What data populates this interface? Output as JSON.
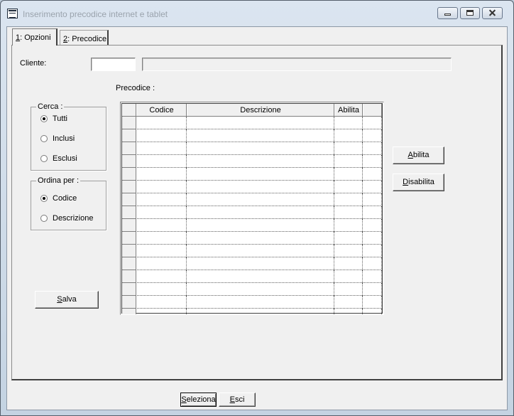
{
  "window": {
    "title": "Inserimento precodice internet e tablet"
  },
  "tabs": [
    {
      "label": "1: Opzioni",
      "mnemonic": "1",
      "rest": ": Opzioni",
      "active": true
    },
    {
      "label": "2: Precodice",
      "mnemonic": "2",
      "rest": ": Precodice",
      "active": false
    }
  ],
  "cliente": {
    "label": "Cliente:",
    "code_value": "",
    "name_value": ""
  },
  "cerca": {
    "legend": "Cerca :",
    "options": [
      {
        "label": "Tutti",
        "selected": true
      },
      {
        "label": "Inclusi",
        "selected": false
      },
      {
        "label": "Esclusi",
        "selected": false
      }
    ]
  },
  "ordina": {
    "legend": "Ordina per :",
    "options": [
      {
        "label": "Codice",
        "selected": true
      },
      {
        "label": "Descrizione",
        "selected": false
      }
    ]
  },
  "precodice": {
    "label": "Precodice :",
    "columns": [
      "Codice",
      "Descrizione",
      "Abilita",
      ""
    ],
    "rows": [
      [
        "",
        "",
        "",
        ""
      ],
      [
        "",
        "",
        "",
        ""
      ],
      [
        "",
        "",
        "",
        ""
      ],
      [
        "",
        "",
        "",
        ""
      ],
      [
        "",
        "",
        "",
        ""
      ],
      [
        "",
        "",
        "",
        ""
      ],
      [
        "",
        "",
        "",
        ""
      ],
      [
        "",
        "",
        "",
        ""
      ],
      [
        "",
        "",
        "",
        ""
      ],
      [
        "",
        "",
        "",
        ""
      ],
      [
        "",
        "",
        "",
        ""
      ],
      [
        "",
        "",
        "",
        ""
      ],
      [
        "",
        "",
        "",
        ""
      ],
      [
        "",
        "",
        "",
        ""
      ],
      [
        "",
        "",
        "",
        ""
      ],
      [
        "",
        "",
        "",
        ""
      ]
    ]
  },
  "buttons": {
    "abilita": {
      "mnemonic": "A",
      "rest": "bilita"
    },
    "disabilita": {
      "mnemonic": "D",
      "rest": "isabilita"
    },
    "salva": {
      "mnemonic": "S",
      "rest": "alva"
    },
    "seleziona": {
      "mnemonic": "S",
      "rest": "eleziona"
    },
    "esci": {
      "mnemonic": "E",
      "rest": "sci"
    }
  },
  "colors": {
    "window_frame": "#c4d3e2",
    "client_bg": "#f0f0f0",
    "title_text": "#9aa3ad"
  }
}
